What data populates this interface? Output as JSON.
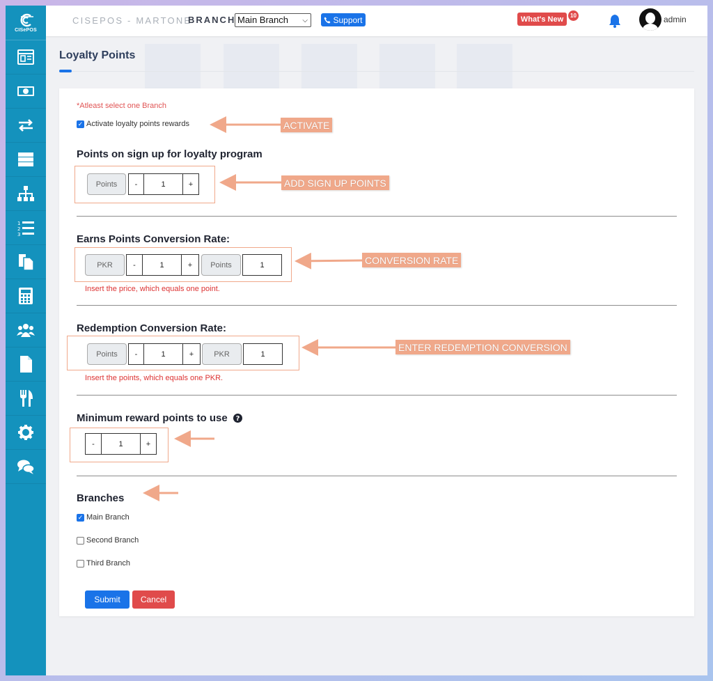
{
  "app": {
    "logo_text": "CISePOS",
    "title": "CISEPOS - MARTONE"
  },
  "header": {
    "branch_label": "BRANCH",
    "branch_selected": "Main Branch",
    "support_label": "Support",
    "whats_new_label": "What's New",
    "notification_count": "10",
    "username": "admin"
  },
  "sidebar": {
    "items": [
      {
        "icon": "dashboard-icon"
      },
      {
        "icon": "cash-icon"
      },
      {
        "icon": "transfer-icon"
      },
      {
        "icon": "server-icon"
      },
      {
        "icon": "sitemap-icon"
      },
      {
        "icon": "numbered-list-icon"
      },
      {
        "icon": "copy-docs-icon"
      },
      {
        "icon": "calculator-icon"
      },
      {
        "icon": "users-icon"
      },
      {
        "icon": "file-icon"
      },
      {
        "icon": "utensils-icon"
      },
      {
        "icon": "gear-icon"
      },
      {
        "icon": "chat-icon"
      }
    ]
  },
  "page": {
    "title": "Loyalty Points"
  },
  "form": {
    "required_note": "*Atleast select one Branch",
    "activate_label": "Activate loyalty points rewards",
    "activate_checked": true,
    "signup": {
      "title": "Points on sign up for loyalty program",
      "addon": "Points",
      "minus": "-",
      "value": "1",
      "plus": "+"
    },
    "earn": {
      "title": "Earns Points Conversion Rate:",
      "currency": "PKR",
      "minus": "-",
      "value": "1",
      "plus": "+",
      "points_addon": "Points",
      "points_value": "1",
      "help": "Insert the price, which equals one point."
    },
    "redeem": {
      "title": "Redemption Conversion Rate:",
      "points_addon": "Points",
      "minus": "-",
      "value": "1",
      "plus": "+",
      "currency": "PKR",
      "currency_value": "1",
      "help": "Insert the points, which equals one PKR."
    },
    "minimum": {
      "title": "Minimum reward points to use",
      "minus": "-",
      "value": "1",
      "plus": "+"
    },
    "branches": {
      "title": "Branches",
      "items": [
        {
          "label": "Main Branch",
          "checked": true
        },
        {
          "label": "Second Branch",
          "checked": false
        },
        {
          "label": "Third Branch",
          "checked": false
        }
      ]
    },
    "submit_label": "Submit",
    "cancel_label": "Cancel"
  },
  "annotations": {
    "activate": "ACTIVATE",
    "signup": "ADD SIGN UP POINTS",
    "conversion": "CONVERSION RATE",
    "redemption": "ENTER REDEMPTION CONVERSION"
  },
  "colors": {
    "sidebar": "#1492bd",
    "primary": "#1a73e8",
    "danger": "#e04b4b",
    "annotation": "#f0a88a"
  }
}
